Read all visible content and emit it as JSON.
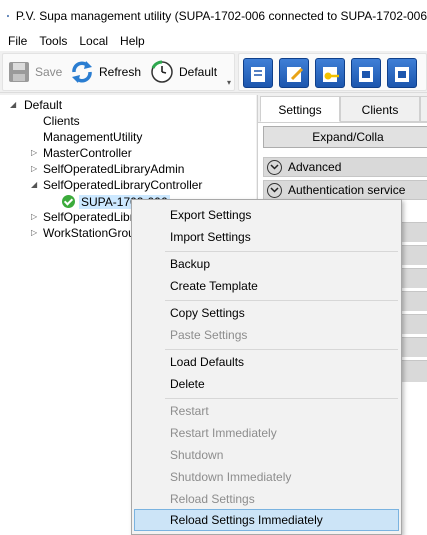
{
  "window": {
    "title": "P.V. Supa management utility (SUPA-1702-006 connected to SUPA-1702-006"
  },
  "menu": [
    "File",
    "Tools",
    "Local",
    "Help"
  ],
  "toolbar": {
    "save_label": "Save",
    "refresh_label": "Refresh",
    "default_label": "Default",
    "icons": [
      "settings-icon",
      "edit-icon",
      "key-icon",
      "module-icon",
      "module-icon-2"
    ]
  },
  "tree": {
    "root": "Default",
    "items": [
      "Clients",
      "ManagementUtility",
      "MasterController",
      "SelfOperatedLibraryAdmin",
      "SelfOperatedLibraryController",
      "SUPA-1702-006",
      "SelfOperatedLibr",
      "WorkStationGrou"
    ]
  },
  "tabs": [
    "Settings",
    "Clients"
  ],
  "panel": {
    "expand_label": "Expand/Colla",
    "groups": [
      "Advanced",
      "Authentication service"
    ]
  },
  "context_menu": {
    "items": [
      {
        "label": "Export Settings",
        "enabled": true
      },
      {
        "label": "Import Settings",
        "enabled": true
      },
      {
        "label": "Backup",
        "enabled": true
      },
      {
        "label": "Create Template",
        "enabled": true
      },
      {
        "label": "Copy Settings",
        "enabled": true
      },
      {
        "label": "Paste Settings",
        "enabled": false
      },
      {
        "label": "Load Defaults",
        "enabled": true
      },
      {
        "label": "Delete",
        "enabled": true
      },
      {
        "label": "Restart",
        "enabled": false
      },
      {
        "label": "Restart Immediately",
        "enabled": false
      },
      {
        "label": "Shutdown",
        "enabled": false
      },
      {
        "label": "Shutdown Immediately",
        "enabled": false
      },
      {
        "label": "Reload Settings",
        "enabled": false
      },
      {
        "label": "Reload Settings Immediately",
        "enabled": true,
        "highlighted": true
      }
    ]
  },
  "colors": {
    "selection": "#cce8ff",
    "menu_highlight": "#cce4f7",
    "status_ok": "#3cab3c",
    "toolbar_icon": "#1c56ae"
  }
}
